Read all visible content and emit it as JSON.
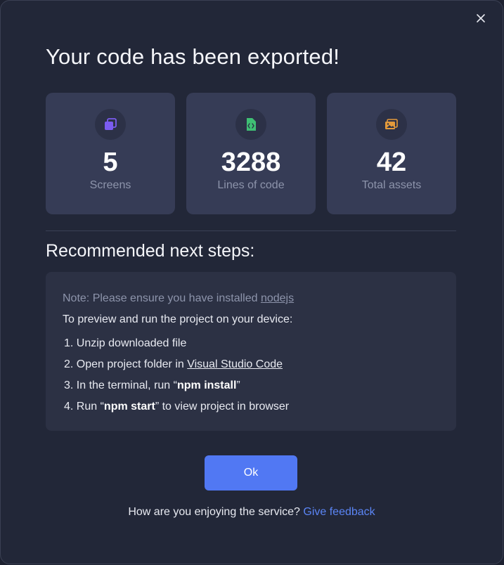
{
  "dialog": {
    "title": "Your code has been exported!",
    "close_icon": "close-icon"
  },
  "stats": [
    {
      "icon": "layers-icon",
      "value": "5",
      "label": "Screens",
      "accent": "#7b5cf0"
    },
    {
      "icon": "code-file-icon",
      "value": "3288",
      "label": "Lines of code",
      "accent": "#3fbf74"
    },
    {
      "icon": "images-icon",
      "value": "42",
      "label": "Total assets",
      "accent": "#e39a3b"
    }
  ],
  "next_steps": {
    "heading": "Recommended next steps:",
    "note_prefix": "Note: Please ensure you have installed ",
    "note_link": "nodejs",
    "intro": "To preview and run the project on your device:",
    "steps": [
      {
        "num": "1.",
        "text": "Unzip downloaded file"
      },
      {
        "num": "2.",
        "pre": "Open project folder in ",
        "link": "Visual Studio Code"
      },
      {
        "num": "3.",
        "pre": "In the terminal, run “",
        "bold": "npm install",
        "post": "”"
      },
      {
        "num": "4.",
        "pre": "Run “",
        "bold": "npm start",
        "post": "” to view project in browser"
      }
    ]
  },
  "ok_button": {
    "label": "Ok"
  },
  "feedback": {
    "question": "How are you enjoying the service? ",
    "link": "Give feedback"
  },
  "colors": {
    "background": "#222738",
    "card": "#363c56",
    "primary": "#5178f3",
    "link": "#5b85f5"
  }
}
